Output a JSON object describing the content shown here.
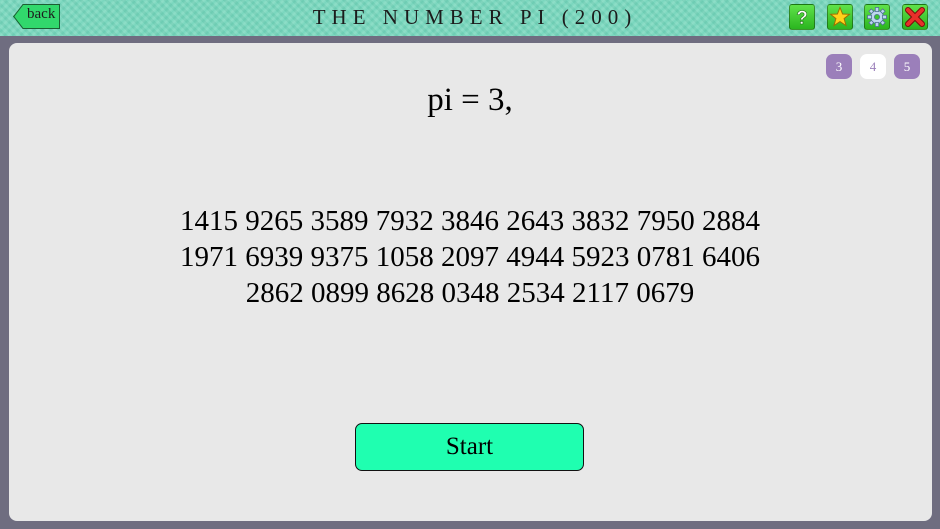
{
  "header": {
    "back_label": "back",
    "title": "THE NUMBER PI (200)",
    "icons": [
      "help-icon",
      "star-icon",
      "gear-icon",
      "close-icon"
    ],
    "help_glyph": "?"
  },
  "levels": {
    "items": [
      "3",
      "4",
      "5"
    ],
    "active": "4"
  },
  "main": {
    "pi_label": "pi = 3,",
    "digit_lines": [
      "1415 9265 3589 7932 3846 2643 3832 7950 2884",
      "1971 6939 9375 1058 2097 4944 5923 0781 6406",
      "2862 0899 8628 0348 2534 2117 0679"
    ],
    "start_label": "Start"
  },
  "colors": {
    "header_bg": "#7ad6bd",
    "frame": "#6f6d80",
    "panel": "#e8e8e8",
    "badge": "#9b7fba",
    "start_button": "#1fffb0",
    "icon_green": "#3cc62e"
  }
}
